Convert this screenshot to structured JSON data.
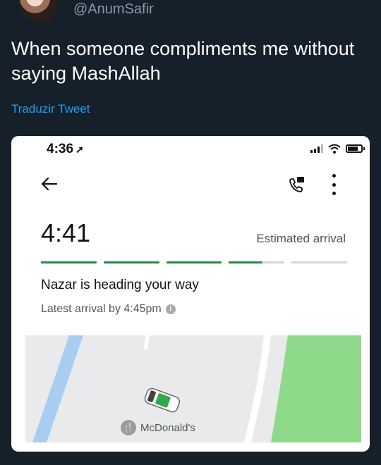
{
  "tweet": {
    "handle": "@AnumSafir",
    "text": "When someone compliments me without saying MashAllah",
    "translate_link": "Traduzir Tweet"
  },
  "screenshot": {
    "status_bar": {
      "time": "4:36",
      "location_arrow": "➚"
    },
    "header": {
      "back_icon": "back-arrow-icon",
      "call_icon": "phone-message-icon",
      "more_icon": "more-vertical-icon"
    },
    "eta": {
      "time": "4:41",
      "label": "Estimated arrival"
    },
    "progress": {
      "total_segments": 5,
      "completed": 3.6
    },
    "status": {
      "title": "Nazar is heading your way",
      "subtitle": "Latest arrival by 4:45pm",
      "info_glyph": "i"
    },
    "map": {
      "poi_label": "McDonald's",
      "poi_glyph": "🍴",
      "colors": {
        "water": "#a9cdf0",
        "park": "#8fd98a",
        "road": "#ffffff",
        "ground": "#e9eaec",
        "car_accent": "#2fa84f"
      }
    }
  }
}
